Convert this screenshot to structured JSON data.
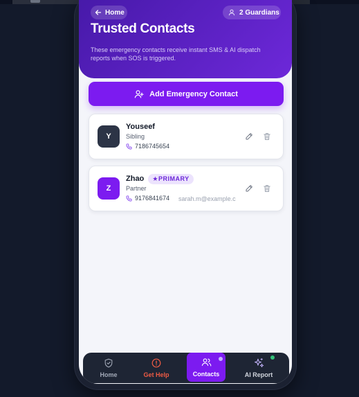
{
  "header": {
    "home_label": "Home",
    "guardians_label": "2 Guardians",
    "title": "Trusted Contacts",
    "subtitle": "These emergency contacts receive instant SMS & AI dispatch reports when SOS is triggered."
  },
  "add_button": {
    "label": "Add Emergency Contact",
    "icon": "user-plus-icon"
  },
  "contacts": [
    {
      "initial": "Y",
      "name": "Youseef",
      "relation": "Sibling",
      "phone": "7186745654",
      "email": "",
      "badge": ""
    },
    {
      "initial": "Z",
      "name": "Zhao",
      "relation": "Partner",
      "phone": "9176841674",
      "email": "sarah.m@example.c",
      "badge": "★PRIMARY"
    }
  ],
  "nav": {
    "items": [
      {
        "label": "Home",
        "icon": "shield-icon"
      },
      {
        "label": "Get Help",
        "icon": "alert-circle-icon"
      },
      {
        "label": "Contacts",
        "icon": "users-icon",
        "active": true
      },
      {
        "label": "AI Report",
        "icon": "sparkles-icon"
      }
    ]
  },
  "colors": {
    "accent": "#7c1bf0",
    "header_start": "#4619a8",
    "header_end": "#6d28d9",
    "danger": "#ef5b44",
    "online": "#34c27a",
    "background": "#131a2b"
  }
}
